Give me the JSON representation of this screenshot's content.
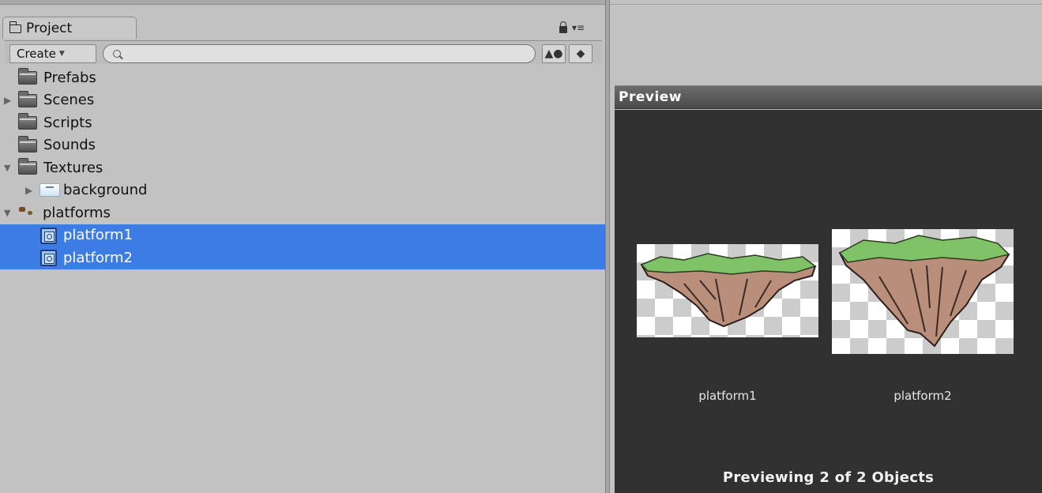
{
  "project_panel": {
    "tab_label": "Project",
    "create_label": "Create",
    "search_value": "",
    "tree": [
      {
        "label": "Prefabs",
        "icon": "folder-icon",
        "expanded": null
      },
      {
        "label": "Scenes",
        "icon": "folder-icon",
        "expanded": false
      },
      {
        "label": "Scripts",
        "icon": "folder-icon",
        "expanded": null
      },
      {
        "label": "Sounds",
        "icon": "folder-icon",
        "expanded": null
      },
      {
        "label": "Textures",
        "icon": "folder-open-icon",
        "expanded": true
      },
      {
        "label": "background",
        "icon": "texture-icon",
        "expanded": false
      },
      {
        "label": "platforms",
        "icon": "sprite-sheet-icon",
        "expanded": true
      },
      {
        "label": "platform1",
        "icon": "sprite-icon",
        "selected": true
      },
      {
        "label": "platform2",
        "icon": "sprite-icon",
        "selected": true
      }
    ]
  },
  "preview_panel": {
    "header": "Preview",
    "items": [
      {
        "name": "platform1"
      },
      {
        "name": "platform2"
      }
    ],
    "footer": "Previewing 2 of 2 Objects"
  },
  "colors": {
    "selection": "#3e7ce5",
    "panel_bg": "#c2c2c2",
    "preview_bg": "#313131"
  }
}
